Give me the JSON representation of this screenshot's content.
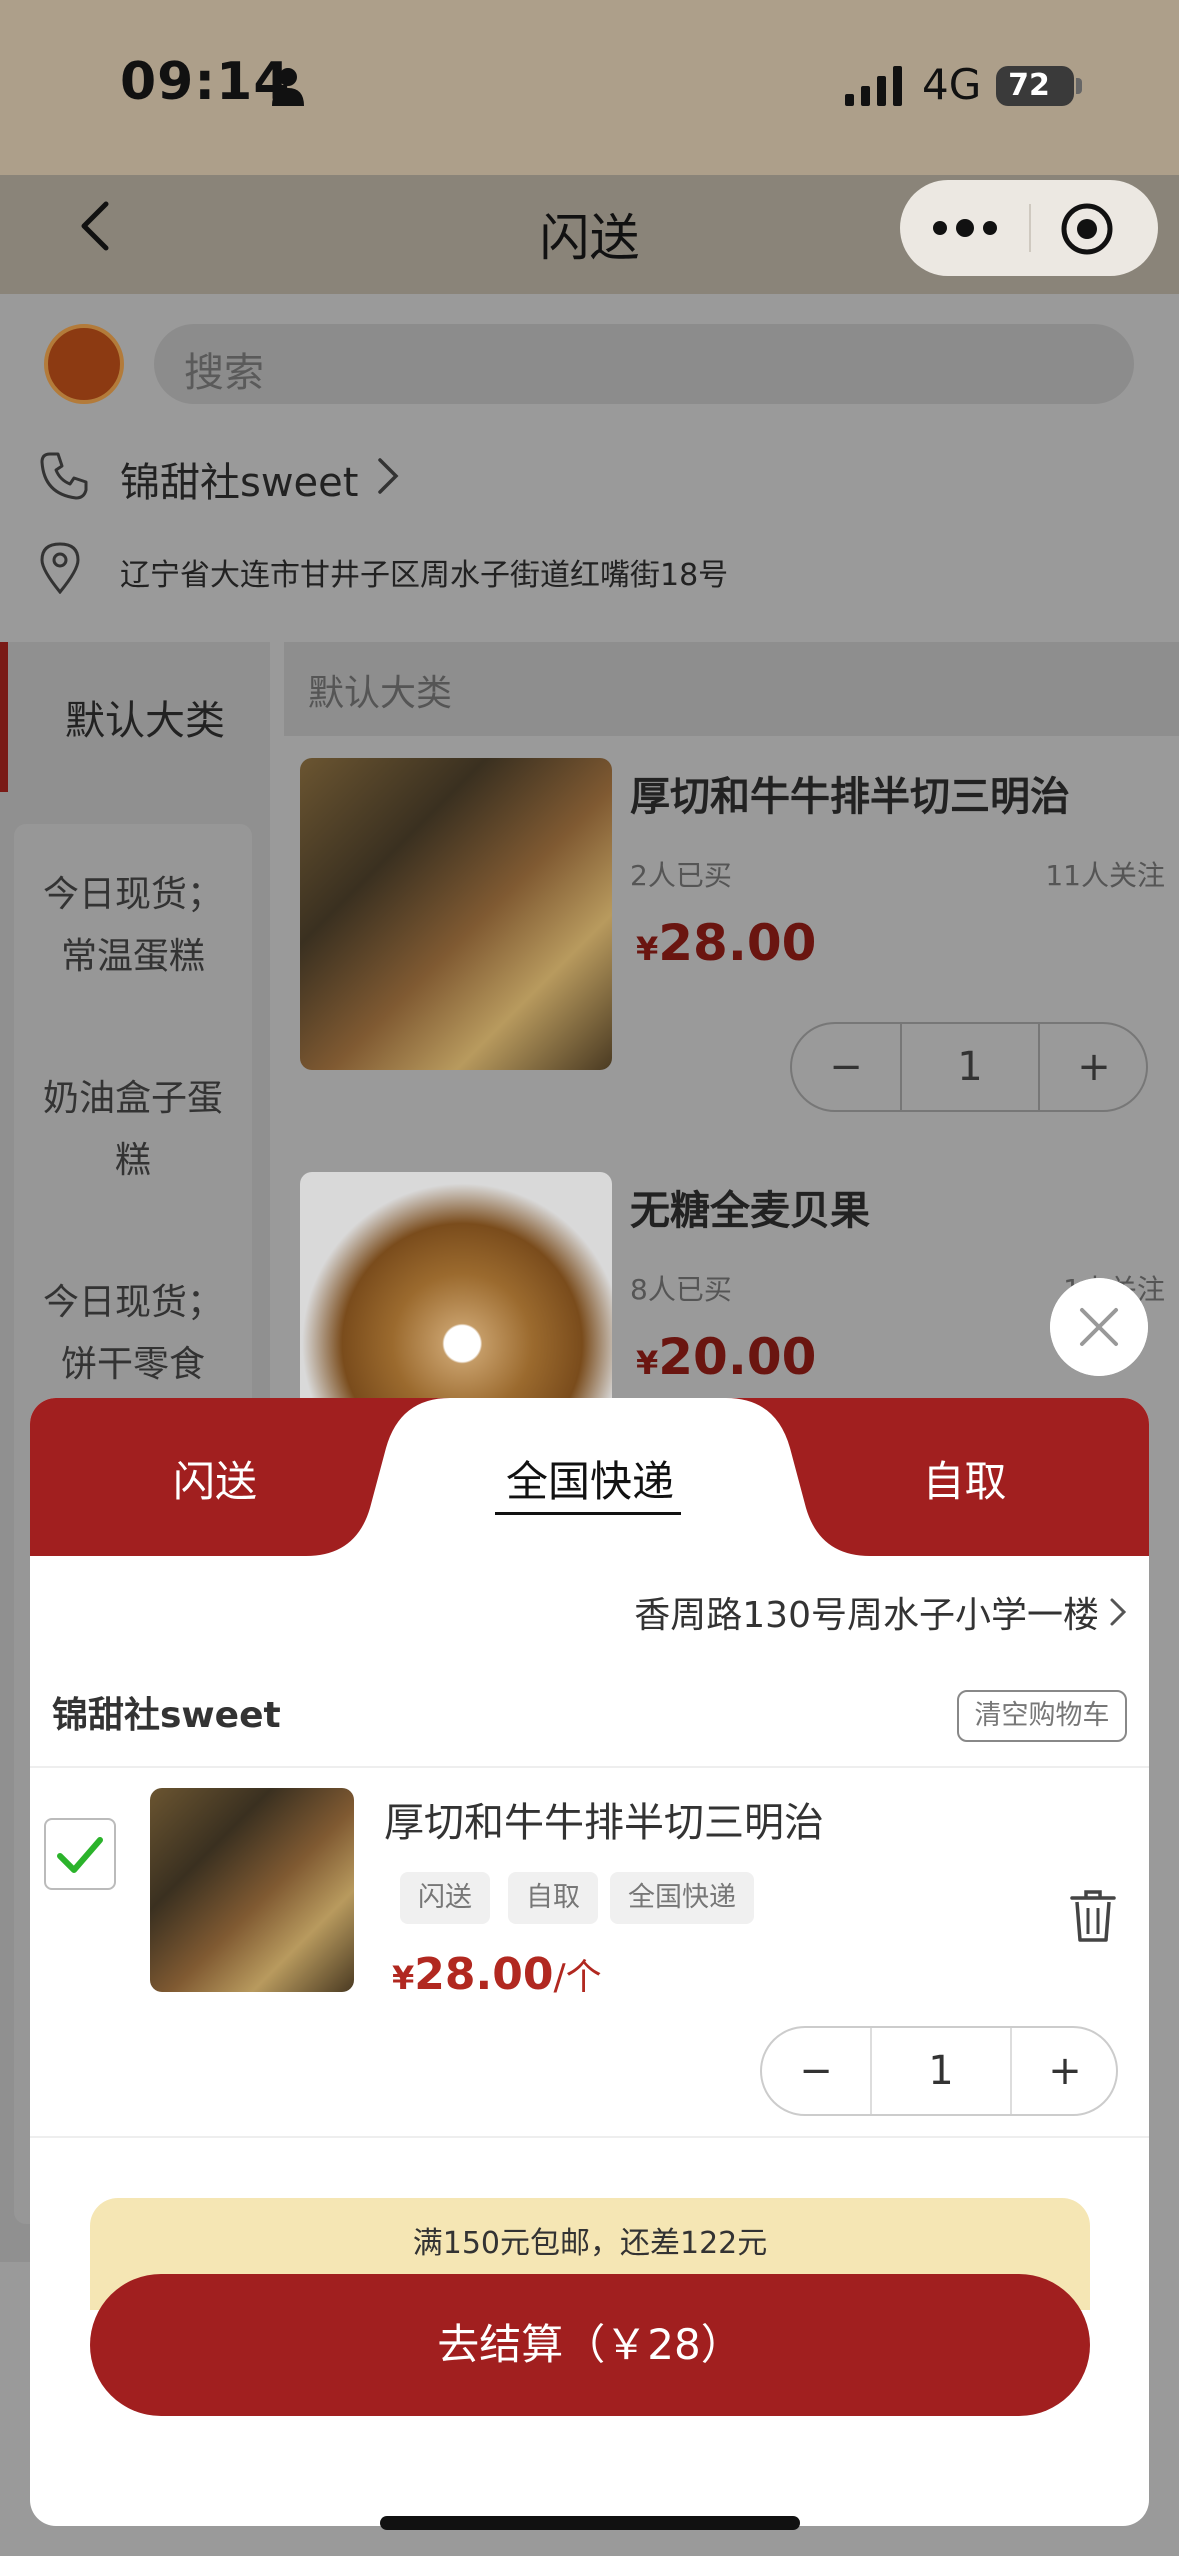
{
  "status_bar": {
    "time": "09:14",
    "network": "4G",
    "battery": "72"
  },
  "nav": {
    "title": "闪送"
  },
  "store": {
    "search_placeholder": "搜索",
    "name": "锦甜社sweet",
    "address": "辽宁省大连市甘井子区周水子街道红嘴街18号"
  },
  "sidebar": {
    "active_category": "默认大类",
    "items": [
      {
        "line1": "今日现货；",
        "line2": "常温蛋糕"
      },
      {
        "line1": "奶油盒子蛋",
        "line2": "糕"
      },
      {
        "line1": "今日现货；",
        "line2": "饼干零食"
      }
    ]
  },
  "content": {
    "header": "默认大类",
    "products": [
      {
        "name": "厚切和牛牛排半切三明治",
        "bought": "2人已买",
        "follow": "11人关注",
        "currency": "¥",
        "price": "28.00",
        "qty": "1",
        "image": "sandwich-image"
      },
      {
        "name": "无糖全麦贝果",
        "bought": "8人已买",
        "follow": "1人关注",
        "currency": "¥",
        "price": "20.00",
        "image": "bagel-image"
      }
    ]
  },
  "sheet": {
    "tabs": [
      {
        "label": "闪送",
        "active": false
      },
      {
        "label": "全国快递",
        "active": true
      },
      {
        "label": "自取",
        "active": false
      }
    ],
    "address": "香周路130号周水子小学一楼",
    "store_name": "锦甜社sweet",
    "clear_cart": "清空购物车",
    "cart_item": {
      "name": "厚切和牛牛排半切三明治",
      "badges": [
        "闪送",
        "自取",
        "全国快递"
      ],
      "currency": "¥",
      "price": "28.00",
      "unit": "/个",
      "qty": "1",
      "checked": true
    },
    "free_shipping_note": "满150元包邮，还差122元",
    "checkout_label": "去结算（￥28）"
  },
  "colors": {
    "brand_red": "#a11f1f",
    "price_red": "#b12820",
    "check_green": "#2bb32b",
    "notice_yellow": "#f5e6b4"
  }
}
